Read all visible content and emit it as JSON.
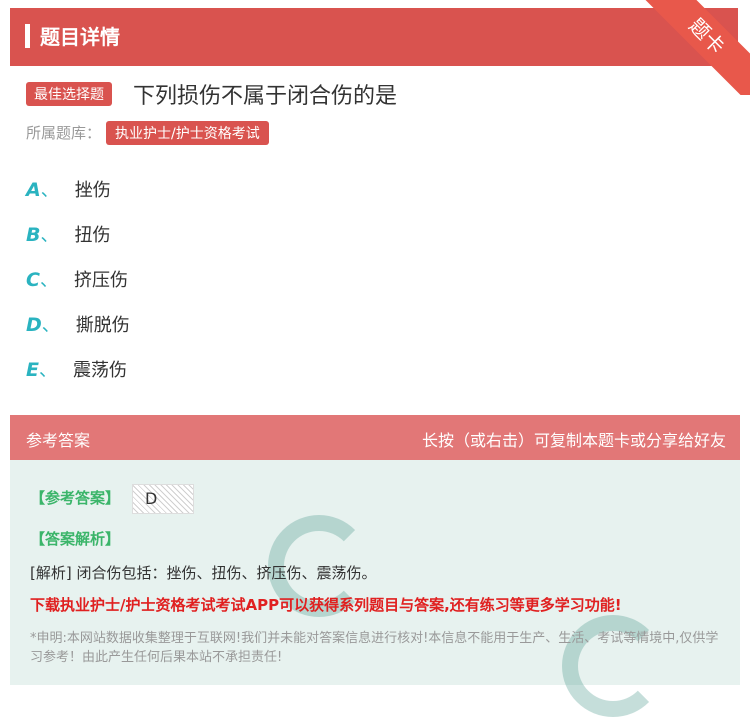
{
  "header": {
    "title": "题目详情",
    "ribbon": "题卡"
  },
  "question": {
    "type_tag": "最佳选择题",
    "text": "下列损伤不属于闭合伤的是",
    "library_label": "所属题库：",
    "library": "执业护士/护士资格考试"
  },
  "options": [
    {
      "letter": "A",
      "text": "挫伤"
    },
    {
      "letter": "B",
      "text": "扭伤"
    },
    {
      "letter": "C",
      "text": "挤压伤"
    },
    {
      "letter": "D",
      "text": "撕脱伤"
    },
    {
      "letter": "E",
      "text": "震荡伤"
    }
  ],
  "answer_section": {
    "title": "参考答案",
    "hint": "长按（或右击）可复制本题卡或分享给好友",
    "answer_label": "【参考答案】",
    "answer_value": "D",
    "explain_label": "【答案解析】",
    "explain_text": "[解析] 闭合伤包括：挫伤、扭伤、挤压伤、震荡伤。",
    "promo": "下载执业护士/护士资格考试考试APP可以获得系列题目与答案,还有练习等更多学习功能!",
    "disclaimer": "*申明:本网站数据收集整理于互联网!我们并未能对答案信息进行核对!本信息不能用于生产、生活、考试等情境中,仅供学习参考！由此产生任何后果本站不承担责任!"
  },
  "colors": {
    "accent": "#d9534f",
    "option_letter": "#2ab3c0",
    "answer_green": "#3bb56a",
    "promo_red": "#e02020"
  }
}
